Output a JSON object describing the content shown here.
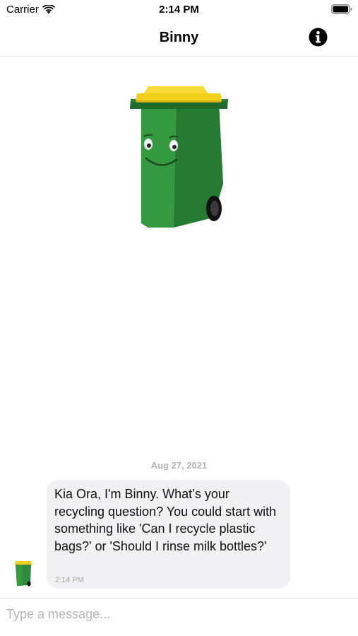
{
  "status_bar": {
    "carrier": "Carrier",
    "time": "2:14 PM"
  },
  "nav": {
    "title": "Binny",
    "info_icon": "info-icon"
  },
  "chat": {
    "date": "Aug 27, 2021",
    "messages": [
      {
        "text": "Kia Ora, I'm Binny. What’s your recycling question? You could start with something like 'Can I recycle plastic bags?' or 'Should I rinse milk bottles?'",
        "time": "2:14 PM"
      }
    ]
  },
  "composer": {
    "placeholder": "Type a message..."
  },
  "colors": {
    "bin_green": "#2e8b3d",
    "bin_lid": "#f2cf1a",
    "bubble_bg": "#f1f1f3"
  }
}
